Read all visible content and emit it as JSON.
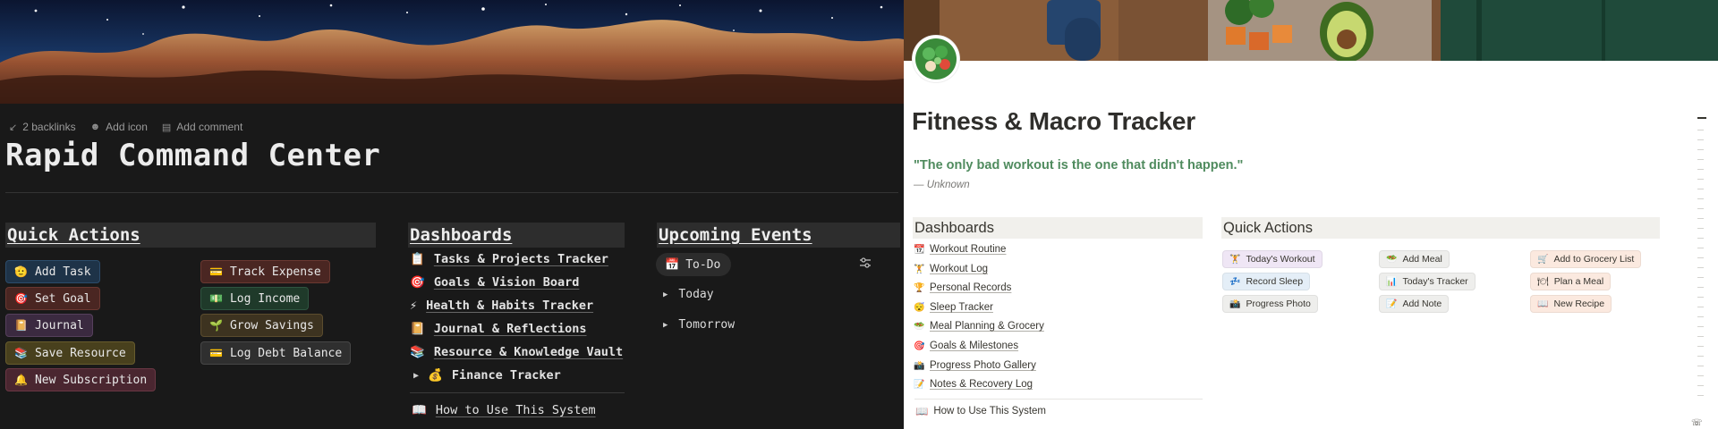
{
  "left": {
    "meta": {
      "backlinks": "2 backlinks",
      "add_icon": "Add icon",
      "add_comment": "Add comment"
    },
    "title": "Rapid Command Center",
    "quick_actions": {
      "heading": "Quick Actions",
      "col1": [
        {
          "emoji": "🫡",
          "label": "Add Task"
        },
        {
          "emoji": "🎯",
          "label": "Set Goal"
        },
        {
          "emoji": "📔",
          "label": "Journal"
        },
        {
          "emoji": "📚",
          "label": "Save Resource"
        },
        {
          "emoji": "🔔",
          "label": "New Subscription"
        }
      ],
      "col2": [
        {
          "emoji": "💳",
          "label": "Track Expense"
        },
        {
          "emoji": "💵",
          "label": "Log Income"
        },
        {
          "emoji": "🌱",
          "label": "Grow Savings"
        },
        {
          "emoji": "💳",
          "label": "Log Debt Balance"
        }
      ]
    },
    "dashboards": {
      "heading": "Dashboards",
      "items": [
        {
          "emoji": "📋",
          "label": "Tasks & Projects Tracker"
        },
        {
          "emoji": "🎯",
          "label": "Goals & Vision Board"
        },
        {
          "emoji": "⚡",
          "label": "Health & Habits Tracker"
        },
        {
          "emoji": "📔",
          "label": "Journal & Reflections"
        },
        {
          "emoji": "📚",
          "label": "Resource & Knowledge Vault"
        }
      ],
      "toggle": {
        "emoji": "💰",
        "label": "Finance Tracker"
      },
      "howto": {
        "emoji": "📖",
        "label": "How to Use This System"
      }
    },
    "events": {
      "heading": "Upcoming Events",
      "tab": {
        "emoji": "📅",
        "label": "To-Do"
      },
      "groups": [
        "Today",
        "Tomorrow"
      ]
    }
  },
  "right": {
    "title": "Fitness & Macro Tracker",
    "quote": "\"The only bad workout is the one that didn't happen.\"",
    "author": "— Unknown",
    "dashboards": {
      "heading": "Dashboards",
      "items": [
        {
          "emoji": "📆",
          "label": "Workout Routine"
        },
        {
          "emoji": "🏋",
          "label": "Workout Log"
        },
        {
          "emoji": "🏆",
          "label": "Personal Records"
        },
        {
          "emoji": "😴",
          "label": "Sleep Tracker"
        },
        {
          "emoji": "🥗",
          "label": "Meal Planning & Grocery"
        },
        {
          "emoji": "🎯",
          "label": "Goals & Milestones"
        },
        {
          "emoji": "📸",
          "label": "Progress Photo Gallery"
        },
        {
          "emoji": "📝",
          "label": "Notes & Recovery Log"
        }
      ],
      "howto": {
        "emoji": "📖",
        "label": "How to Use This System"
      }
    },
    "quick_actions": {
      "heading": "Quick Actions",
      "col1": [
        {
          "emoji": "🏋",
          "label": "Today's Workout"
        },
        {
          "emoji": "💤",
          "label": "Record Sleep"
        },
        {
          "emoji": "📸",
          "label": "Progress Photo"
        }
      ],
      "col2": [
        {
          "emoji": "🥗",
          "label": "Add Meal"
        },
        {
          "emoji": "📊",
          "label": "Today's Tracker"
        },
        {
          "emoji": "📝",
          "label": "Add Note"
        }
      ],
      "col3": [
        {
          "emoji": "🛒",
          "label": "Add to Grocery List"
        },
        {
          "emoji": "🍽",
          "label": "Plan a Meal"
        },
        {
          "emoji": "📖",
          "label": "New Recipe"
        }
      ]
    }
  },
  "colors": {
    "dark_bg": "#191919",
    "light_bg": "#ffffff",
    "quote_green": "#4f8b5e"
  }
}
